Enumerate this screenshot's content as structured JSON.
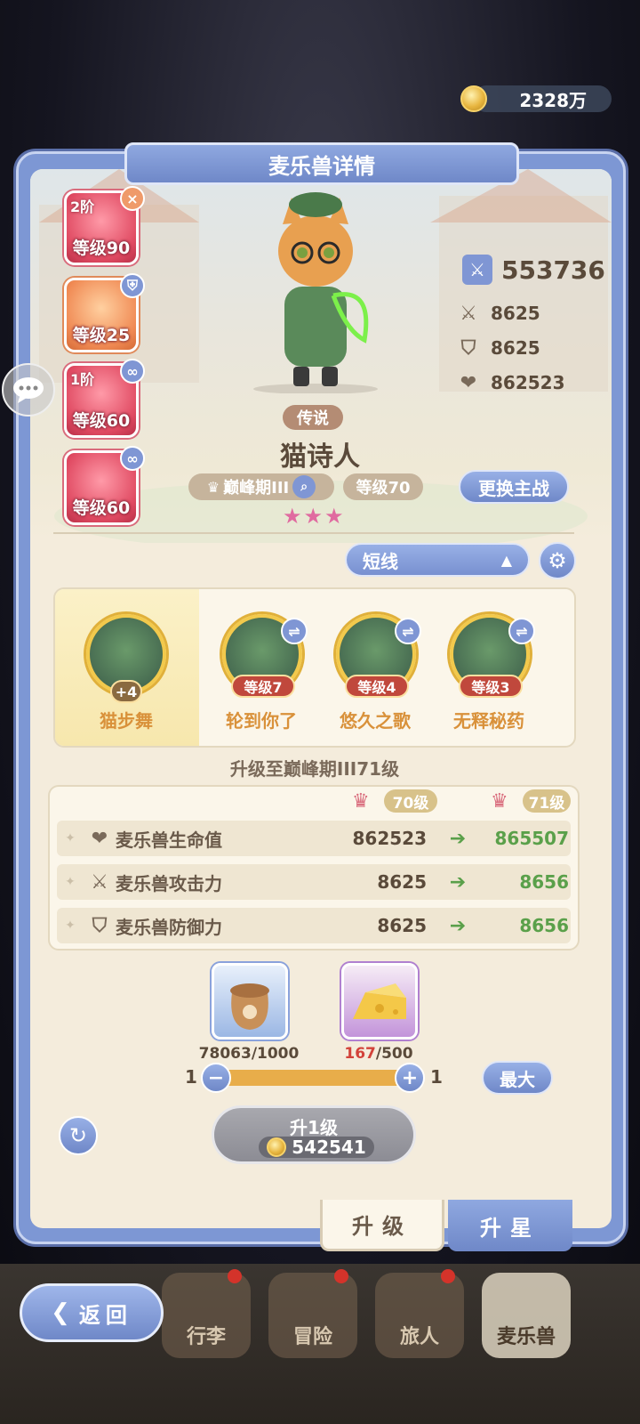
{
  "currency": {
    "amount": "2328万"
  },
  "header": {
    "title": "麦乐兽详情"
  },
  "equipment": [
    {
      "tier": "2阶",
      "level": "等级90",
      "badge": "×",
      "color": "#e35b71"
    },
    {
      "tier": "",
      "level": "等级25",
      "badge": "⛨",
      "color": "#f08a54"
    },
    {
      "tier": "1阶",
      "level": "等级60",
      "badge": "∞",
      "color": "#e35b71"
    },
    {
      "tier": "",
      "level": "等级60",
      "badge": "∞",
      "color": "#e35b71"
    }
  ],
  "stats": {
    "power": "553736",
    "attack": "8625",
    "defense": "8625",
    "hp": "862523"
  },
  "pet": {
    "rarity": "传说",
    "name": "猫诗人",
    "stage": "巅峰期III",
    "level": "等级70",
    "stars": "★★★",
    "swap_label": "更换主战"
  },
  "line_select": {
    "value": "短线"
  },
  "skills": {
    "main": {
      "name": "猫步舞",
      "plus": "+4"
    },
    "items": [
      {
        "name": "轮到你了",
        "level": "等级7"
      },
      {
        "name": "悠久之歌",
        "level": "等级4"
      },
      {
        "name": "无释秘药",
        "level": "等级3"
      }
    ]
  },
  "upgrade": {
    "title": "升级至巅峰期III71级",
    "from_level": "70级",
    "to_level": "71级",
    "rows": [
      {
        "icon": "heart-icon",
        "glyph": "❤",
        "label": "麦乐兽生命值",
        "current": "862523",
        "next": "865507"
      },
      {
        "icon": "swords-icon",
        "glyph": "⚔",
        "label": "麦乐兽攻击力",
        "current": "8625",
        "next": "8656"
      },
      {
        "icon": "shield-icon",
        "glyph": "⛉",
        "label": "麦乐兽防御力",
        "current": "8625",
        "next": "8656"
      }
    ]
  },
  "materials": [
    {
      "icon": "pet-food-bag-icon",
      "have": "78063",
      "need": "/1000"
    },
    {
      "icon": "cheese-icon",
      "have": "167",
      "need": "/500"
    }
  ],
  "quantity": {
    "min": "1",
    "max": "1",
    "minus": "−",
    "plus": "+",
    "max_label": "最大"
  },
  "upgrade_button": {
    "label": "升1级",
    "cost": "542541"
  },
  "tabs": {
    "upgrade": "升级",
    "star": "升星"
  },
  "bottom_nav": {
    "back": "返回",
    "items": [
      "行李",
      "冒险",
      "旅人",
      "麦乐兽"
    ]
  }
}
